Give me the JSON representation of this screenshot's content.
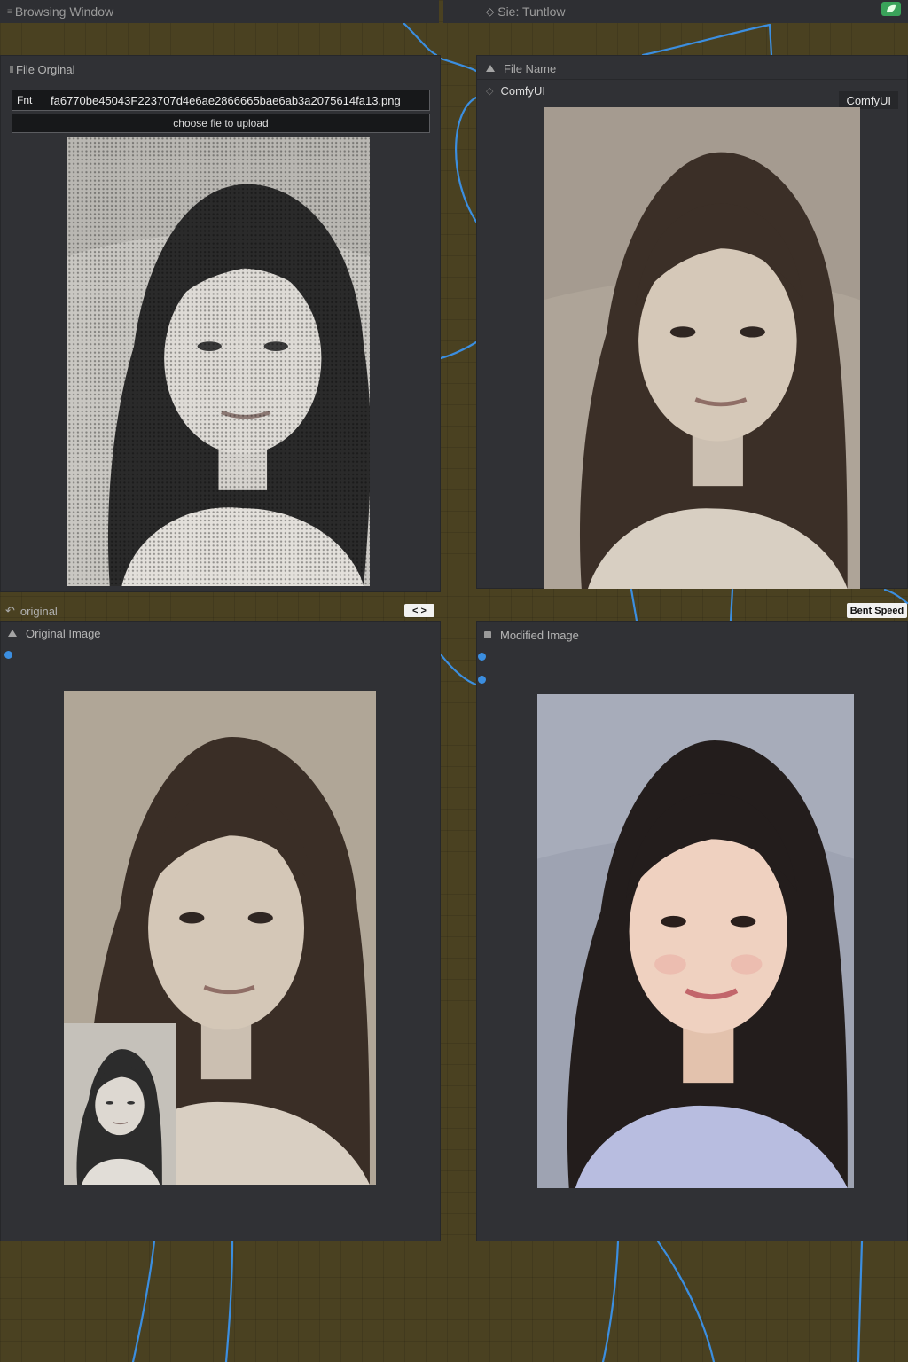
{
  "window": {
    "title": "Browsing Window"
  },
  "topbar_right": {
    "title": "Sie: Tuntlow"
  },
  "file_node": {
    "section_label": "File Orginal",
    "filename_label": "Fnt",
    "filename_value": "fa6770be45043F223707d4e6ae2866665bae6ab3a2075614fa13.png",
    "upload_label": "choose fie to upload"
  },
  "comfy_node": {
    "header": "File Name",
    "subheader": "ComfyUI",
    "tag": "ComfyUI"
  },
  "original_node": {
    "title": "original",
    "header": "Original Image",
    "badge": "< >"
  },
  "modified_node": {
    "header": "Modified Image",
    "badge": "Bent Speed"
  },
  "icons": [
    "leaf-icon",
    "diamond-icon",
    "triangle-icon",
    "undo-icon",
    "square-icon"
  ],
  "colors": {
    "canvas": "#4a4121",
    "node": "#303135",
    "wire": "#3b8ee0",
    "accent_green": "#3aa35a"
  }
}
